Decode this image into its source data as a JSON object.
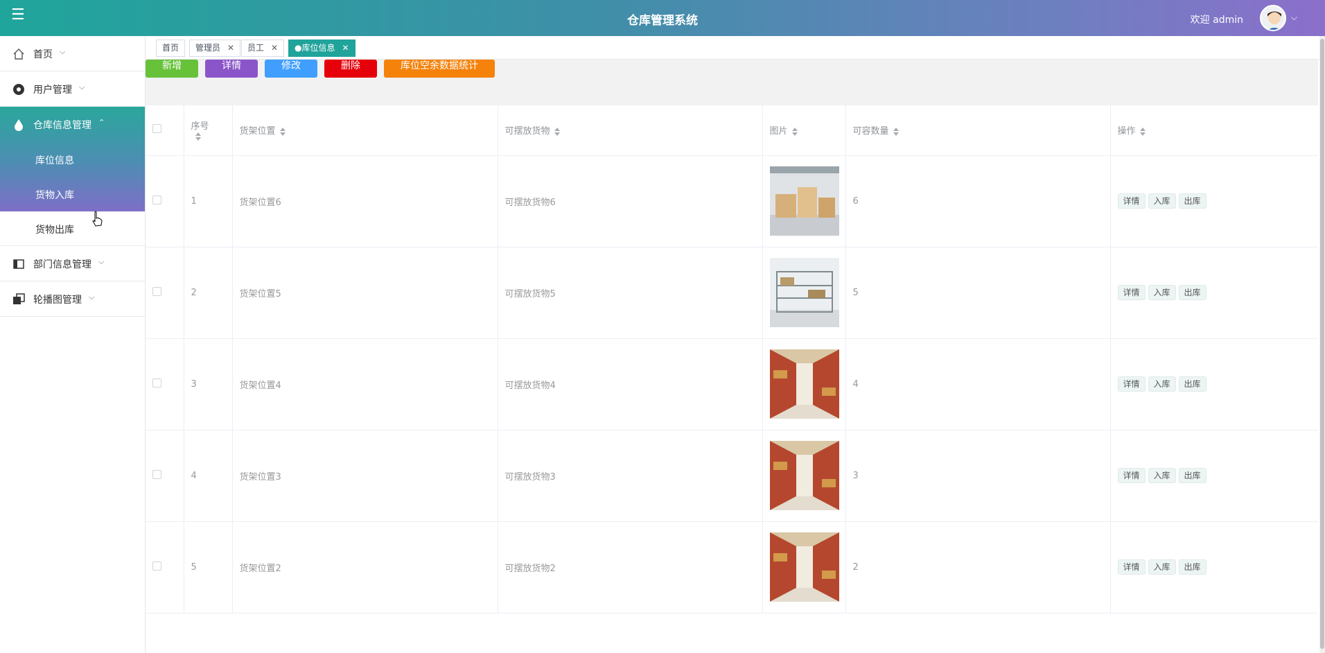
{
  "app": {
    "title": "仓库管理系统",
    "welcome": "欢迎 admin"
  },
  "tabs": [
    {
      "label": "首页",
      "closable": false,
      "active": false
    },
    {
      "label": "管理员",
      "closable": true,
      "active": false
    },
    {
      "label": "员工",
      "closable": true,
      "active": false
    },
    {
      "label": "●库位信息",
      "closable": true,
      "active": true
    }
  ],
  "sidebar": {
    "items": [
      {
        "label": "首页",
        "icon": "home-icon"
      },
      {
        "label": "用户管理",
        "icon": "user-icon"
      },
      {
        "label": "仓库信息管理",
        "icon": "drop-icon",
        "expanded": true,
        "children": [
          {
            "label": "库位信息"
          },
          {
            "label": "货物入库"
          },
          {
            "label": "货物出库"
          }
        ]
      },
      {
        "label": "部门信息管理",
        "icon": "panel-icon"
      },
      {
        "label": "轮播图管理",
        "icon": "copy-icon"
      }
    ]
  },
  "toolbar": {
    "add": "新增",
    "detail": "详情",
    "edit": "修改",
    "delete": "删除",
    "stats": "库位空余数据统计"
  },
  "table": {
    "columns": [
      "序号",
      "货架位置",
      "可摆放货物",
      "图片",
      "可容数量",
      "操作"
    ],
    "row_actions": [
      "详情",
      "入库",
      "出库"
    ],
    "rows": [
      {
        "no": "1",
        "location": "货架位置6",
        "goods": "可摆放货物6",
        "capacity": "6",
        "image": "warehouse-boxes"
      },
      {
        "no": "2",
        "location": "货架位置5",
        "goods": "可摆放货物5",
        "capacity": "5",
        "image": "warehouse-shelves"
      },
      {
        "no": "3",
        "location": "货架位置4",
        "goods": "可摆放货物4",
        "capacity": "4",
        "image": "warehouse-aisle"
      },
      {
        "no": "4",
        "location": "货架位置3",
        "goods": "可摆放货物3",
        "capacity": "3",
        "image": "warehouse-aisle"
      },
      {
        "no": "5",
        "location": "货架位置2",
        "goods": "可摆放货物2",
        "capacity": "2",
        "image": "warehouse-aisle"
      }
    ]
  }
}
